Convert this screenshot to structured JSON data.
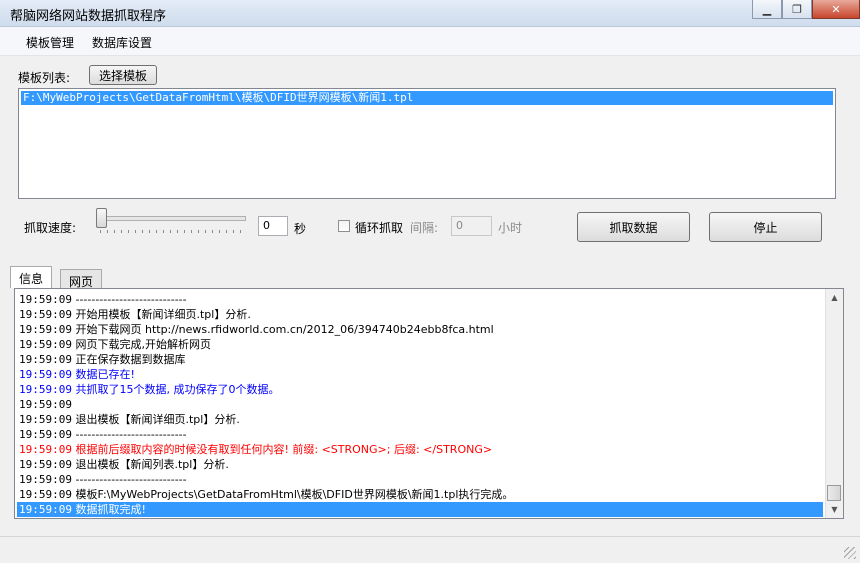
{
  "window": {
    "title": "帮脑网络网站数据抓取程序"
  },
  "menu": {
    "items": [
      "模板管理",
      "数据库设置"
    ]
  },
  "template": {
    "list_label": "模板列表:",
    "select_button": "选择模板",
    "items": [
      "F:\\MyWebProjects\\GetDataFromHtml\\模板\\DFID世界网模板\\新闻1.tpl"
    ]
  },
  "controls": {
    "speed_label": "抓取速度:",
    "speed_value": "0",
    "speed_unit": "秒",
    "loop_label": "循环抓取",
    "loop_checked": false,
    "interval_label": "间隔:",
    "interval_value": "0",
    "interval_unit": "小时",
    "fetch_button": "抓取数据",
    "stop_button": "停止"
  },
  "tabs": {
    "active": "信息",
    "other": "网页"
  },
  "log": [
    {
      "time": "19:59:09",
      "text": "----------------------------",
      "color": "black"
    },
    {
      "time": "19:59:09",
      "text": "开始用模板【新闻详细页.tpl】分析.",
      "color": "black"
    },
    {
      "time": "19:59:09",
      "text": "开始下载网页 http://news.rfidworld.com.cn/2012_06/394740b24ebb8fca.html",
      "color": "black"
    },
    {
      "time": "19:59:09",
      "text": "网页下载完成,开始解析网页",
      "color": "black"
    },
    {
      "time": "19:59:09",
      "text": "正在保存数据到数据库",
      "color": "black"
    },
    {
      "time": "19:59:09",
      "text": "数据已存在!",
      "color": "blue"
    },
    {
      "time": "19:59:09",
      "text": "共抓取了15个数据, 成功保存了0个数据。",
      "color": "blue"
    },
    {
      "time": "19:59:09",
      "text": "",
      "color": "black"
    },
    {
      "time": "19:59:09",
      "text": "退出模板【新闻详细页.tpl】分析.",
      "color": "black"
    },
    {
      "time": "19:59:09",
      "text": "----------------------------",
      "color": "black"
    },
    {
      "time": "19:59:09",
      "text": "根据前后缀取内容的时候没有取到任何内容! 前缀: <STRONG>; 后缀: </STRONG>",
      "color": "red"
    },
    {
      "time": "19:59:09",
      "text": "退出模板【新闻列表.tpl】分析.",
      "color": "black"
    },
    {
      "time": "19:59:09",
      "text": "----------------------------",
      "color": "black"
    },
    {
      "time": "19:59:09",
      "text": "模板F:\\MyWebProjects\\GetDataFromHtml\\模板\\DFID世界网模板\\新闻1.tpl执行完成。",
      "color": "black"
    },
    {
      "time": "19:59:09",
      "text": "数据抓取完成!",
      "color": "selected"
    }
  ]
}
